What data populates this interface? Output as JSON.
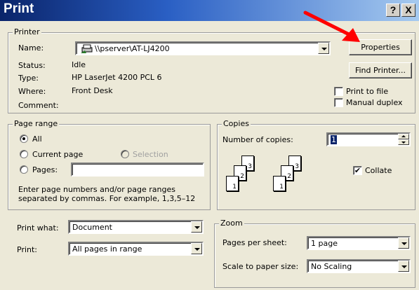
{
  "window": {
    "title": "Print",
    "help_button": "?",
    "close_button": "X"
  },
  "printer": {
    "group_label": "Printer",
    "name_label": "Name:",
    "name_value": "\\\\pserver\\AT-LJ4200",
    "properties_button": "Properties",
    "find_printer_button": "Find Printer...",
    "status_label": "Status:",
    "status_value": "Idle",
    "type_label": "Type:",
    "type_value": "HP LaserJet 4200 PCL 6",
    "where_label": "Where:",
    "where_value": "Front Desk",
    "comment_label": "Comment:",
    "comment_value": "",
    "print_to_file_label": "Print to file",
    "print_to_file_checked": false,
    "manual_duplex_label": "Manual duplex",
    "manual_duplex_checked": false
  },
  "page_range": {
    "group_label": "Page range",
    "all_label": "All",
    "current_page_label": "Current page",
    "selection_label": "Selection",
    "pages_label": "Pages:",
    "pages_value": "",
    "selected": "All",
    "hint": "Enter page numbers and/or page ranges separated by commas.  For example, 1,3,5–12"
  },
  "copies": {
    "group_label": "Copies",
    "number_label": "Number of copies:",
    "number_value": "1",
    "collate_label": "Collate",
    "collate_checked": true,
    "set_a_pages": [
      "3",
      "2",
      "1"
    ],
    "set_b_pages": [
      "3",
      "2",
      "1"
    ]
  },
  "print_what": {
    "label": "Print what:",
    "value": "Document"
  },
  "print": {
    "label": "Print:",
    "value": "All pages in range"
  },
  "zoom": {
    "group_label": "Zoom",
    "pages_per_sheet_label": "Pages per sheet:",
    "pages_per_sheet_value": "1 page",
    "scale_label": "Scale to paper size:",
    "scale_value": "No Scaling"
  },
  "annotation": {
    "arrow_color": "#ff0000"
  }
}
